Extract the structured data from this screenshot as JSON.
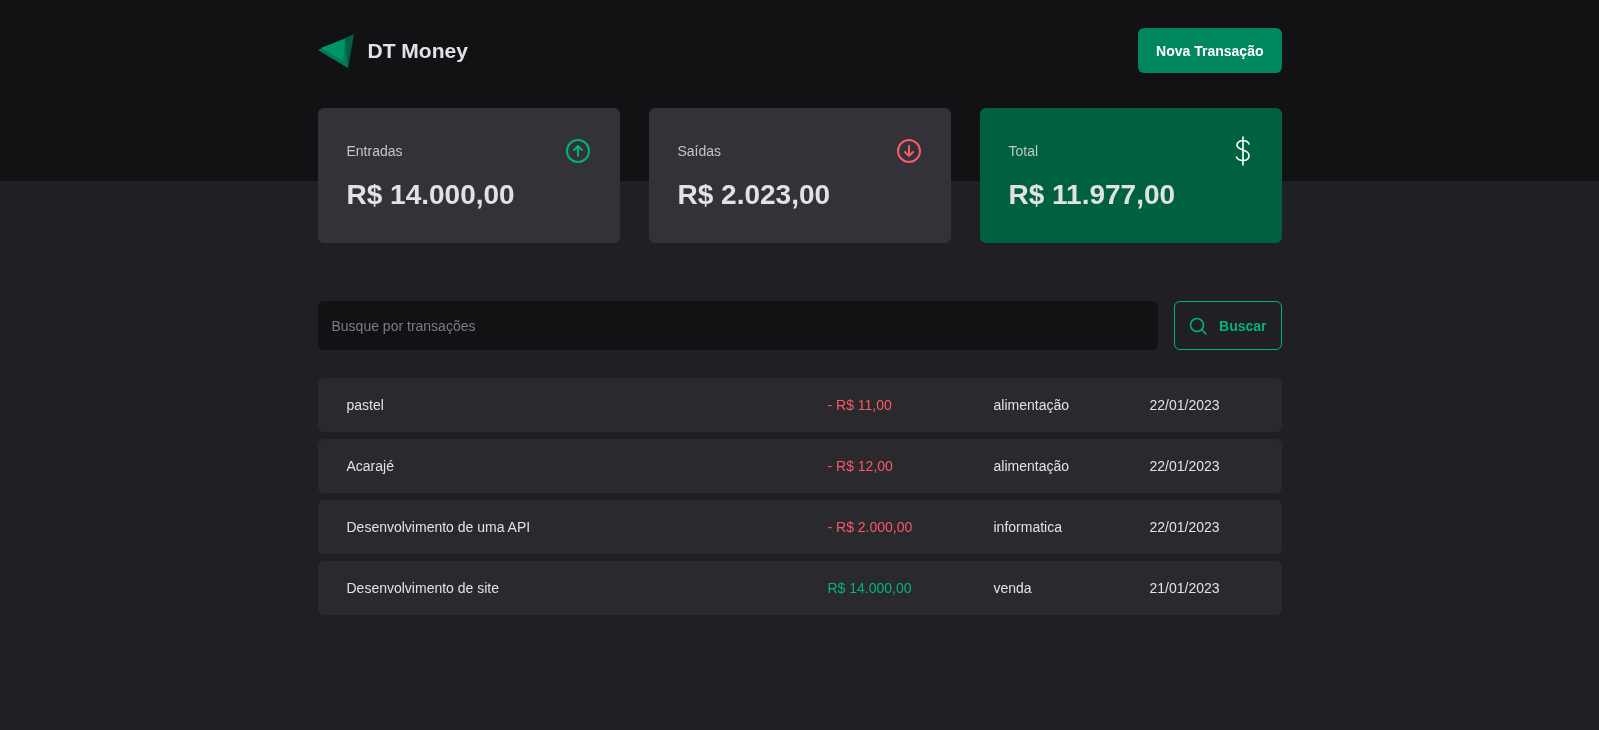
{
  "header": {
    "logo_text": "DT Money",
    "new_button": "Nova Transação"
  },
  "summary": [
    {
      "kind": "income",
      "label": "Entradas",
      "value": "R$ 14.000,00"
    },
    {
      "kind": "outcome",
      "label": "Saídas",
      "value": "R$ 2.023,00"
    },
    {
      "kind": "total",
      "label": "Total",
      "value": "R$ 11.977,00"
    }
  ],
  "search": {
    "placeholder": "Busque por transações",
    "button": "Buscar"
  },
  "transactions": [
    {
      "description": "pastel",
      "kind": "outcome",
      "price": "- R$ 11,00",
      "category": "alimentação",
      "date": "22/01/2023"
    },
    {
      "description": "Acarajé",
      "kind": "outcome",
      "price": "- R$ 12,00",
      "category": "alimentação",
      "date": "22/01/2023"
    },
    {
      "description": "Desenvolvimento de uma API",
      "kind": "outcome",
      "price": "- R$ 2.000,00",
      "category": "informatica",
      "date": "22/01/2023"
    },
    {
      "description": "Desenvolvimento de site",
      "kind": "income",
      "price": "R$ 14.000,00",
      "category": "venda",
      "date": "21/01/2023"
    }
  ]
}
